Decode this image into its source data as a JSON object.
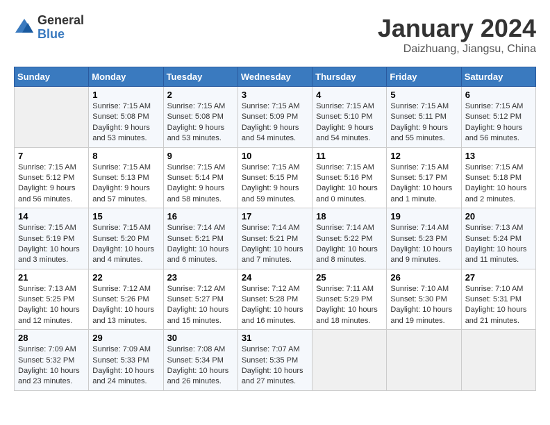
{
  "logo": {
    "general": "General",
    "blue": "Blue"
  },
  "title": {
    "month": "January 2024",
    "location": "Daizhuang, Jiangsu, China"
  },
  "headers": [
    "Sunday",
    "Monday",
    "Tuesday",
    "Wednesday",
    "Thursday",
    "Friday",
    "Saturday"
  ],
  "weeks": [
    [
      {
        "day": "",
        "sunrise": "",
        "sunset": "",
        "daylight": ""
      },
      {
        "day": "1",
        "sunrise": "Sunrise: 7:15 AM",
        "sunset": "Sunset: 5:08 PM",
        "daylight": "Daylight: 9 hours and 53 minutes."
      },
      {
        "day": "2",
        "sunrise": "Sunrise: 7:15 AM",
        "sunset": "Sunset: 5:08 PM",
        "daylight": "Daylight: 9 hours and 53 minutes."
      },
      {
        "day": "3",
        "sunrise": "Sunrise: 7:15 AM",
        "sunset": "Sunset: 5:09 PM",
        "daylight": "Daylight: 9 hours and 54 minutes."
      },
      {
        "day": "4",
        "sunrise": "Sunrise: 7:15 AM",
        "sunset": "Sunset: 5:10 PM",
        "daylight": "Daylight: 9 hours and 54 minutes."
      },
      {
        "day": "5",
        "sunrise": "Sunrise: 7:15 AM",
        "sunset": "Sunset: 5:11 PM",
        "daylight": "Daylight: 9 hours and 55 minutes."
      },
      {
        "day": "6",
        "sunrise": "Sunrise: 7:15 AM",
        "sunset": "Sunset: 5:12 PM",
        "daylight": "Daylight: 9 hours and 56 minutes."
      }
    ],
    [
      {
        "day": "7",
        "sunrise": "Sunrise: 7:15 AM",
        "sunset": "Sunset: 5:12 PM",
        "daylight": "Daylight: 9 hours and 56 minutes."
      },
      {
        "day": "8",
        "sunrise": "Sunrise: 7:15 AM",
        "sunset": "Sunset: 5:13 PM",
        "daylight": "Daylight: 9 hours and 57 minutes."
      },
      {
        "day": "9",
        "sunrise": "Sunrise: 7:15 AM",
        "sunset": "Sunset: 5:14 PM",
        "daylight": "Daylight: 9 hours and 58 minutes."
      },
      {
        "day": "10",
        "sunrise": "Sunrise: 7:15 AM",
        "sunset": "Sunset: 5:15 PM",
        "daylight": "Daylight: 9 hours and 59 minutes."
      },
      {
        "day": "11",
        "sunrise": "Sunrise: 7:15 AM",
        "sunset": "Sunset: 5:16 PM",
        "daylight": "Daylight: 10 hours and 0 minutes."
      },
      {
        "day": "12",
        "sunrise": "Sunrise: 7:15 AM",
        "sunset": "Sunset: 5:17 PM",
        "daylight": "Daylight: 10 hours and 1 minute."
      },
      {
        "day": "13",
        "sunrise": "Sunrise: 7:15 AM",
        "sunset": "Sunset: 5:18 PM",
        "daylight": "Daylight: 10 hours and 2 minutes."
      }
    ],
    [
      {
        "day": "14",
        "sunrise": "Sunrise: 7:15 AM",
        "sunset": "Sunset: 5:19 PM",
        "daylight": "Daylight: 10 hours and 3 minutes."
      },
      {
        "day": "15",
        "sunrise": "Sunrise: 7:15 AM",
        "sunset": "Sunset: 5:20 PM",
        "daylight": "Daylight: 10 hours and 4 minutes."
      },
      {
        "day": "16",
        "sunrise": "Sunrise: 7:14 AM",
        "sunset": "Sunset: 5:21 PM",
        "daylight": "Daylight: 10 hours and 6 minutes."
      },
      {
        "day": "17",
        "sunrise": "Sunrise: 7:14 AM",
        "sunset": "Sunset: 5:21 PM",
        "daylight": "Daylight: 10 hours and 7 minutes."
      },
      {
        "day": "18",
        "sunrise": "Sunrise: 7:14 AM",
        "sunset": "Sunset: 5:22 PM",
        "daylight": "Daylight: 10 hours and 8 minutes."
      },
      {
        "day": "19",
        "sunrise": "Sunrise: 7:14 AM",
        "sunset": "Sunset: 5:23 PM",
        "daylight": "Daylight: 10 hours and 9 minutes."
      },
      {
        "day": "20",
        "sunrise": "Sunrise: 7:13 AM",
        "sunset": "Sunset: 5:24 PM",
        "daylight": "Daylight: 10 hours and 11 minutes."
      }
    ],
    [
      {
        "day": "21",
        "sunrise": "Sunrise: 7:13 AM",
        "sunset": "Sunset: 5:25 PM",
        "daylight": "Daylight: 10 hours and 12 minutes."
      },
      {
        "day": "22",
        "sunrise": "Sunrise: 7:12 AM",
        "sunset": "Sunset: 5:26 PM",
        "daylight": "Daylight: 10 hours and 13 minutes."
      },
      {
        "day": "23",
        "sunrise": "Sunrise: 7:12 AM",
        "sunset": "Sunset: 5:27 PM",
        "daylight": "Daylight: 10 hours and 15 minutes."
      },
      {
        "day": "24",
        "sunrise": "Sunrise: 7:12 AM",
        "sunset": "Sunset: 5:28 PM",
        "daylight": "Daylight: 10 hours and 16 minutes."
      },
      {
        "day": "25",
        "sunrise": "Sunrise: 7:11 AM",
        "sunset": "Sunset: 5:29 PM",
        "daylight": "Daylight: 10 hours and 18 minutes."
      },
      {
        "day": "26",
        "sunrise": "Sunrise: 7:10 AM",
        "sunset": "Sunset: 5:30 PM",
        "daylight": "Daylight: 10 hours and 19 minutes."
      },
      {
        "day": "27",
        "sunrise": "Sunrise: 7:10 AM",
        "sunset": "Sunset: 5:31 PM",
        "daylight": "Daylight: 10 hours and 21 minutes."
      }
    ],
    [
      {
        "day": "28",
        "sunrise": "Sunrise: 7:09 AM",
        "sunset": "Sunset: 5:32 PM",
        "daylight": "Daylight: 10 hours and 23 minutes."
      },
      {
        "day": "29",
        "sunrise": "Sunrise: 7:09 AM",
        "sunset": "Sunset: 5:33 PM",
        "daylight": "Daylight: 10 hours and 24 minutes."
      },
      {
        "day": "30",
        "sunrise": "Sunrise: 7:08 AM",
        "sunset": "Sunset: 5:34 PM",
        "daylight": "Daylight: 10 hours and 26 minutes."
      },
      {
        "day": "31",
        "sunrise": "Sunrise: 7:07 AM",
        "sunset": "Sunset: 5:35 PM",
        "daylight": "Daylight: 10 hours and 27 minutes."
      },
      {
        "day": "",
        "sunrise": "",
        "sunset": "",
        "daylight": ""
      },
      {
        "day": "",
        "sunrise": "",
        "sunset": "",
        "daylight": ""
      },
      {
        "day": "",
        "sunrise": "",
        "sunset": "",
        "daylight": ""
      }
    ]
  ]
}
